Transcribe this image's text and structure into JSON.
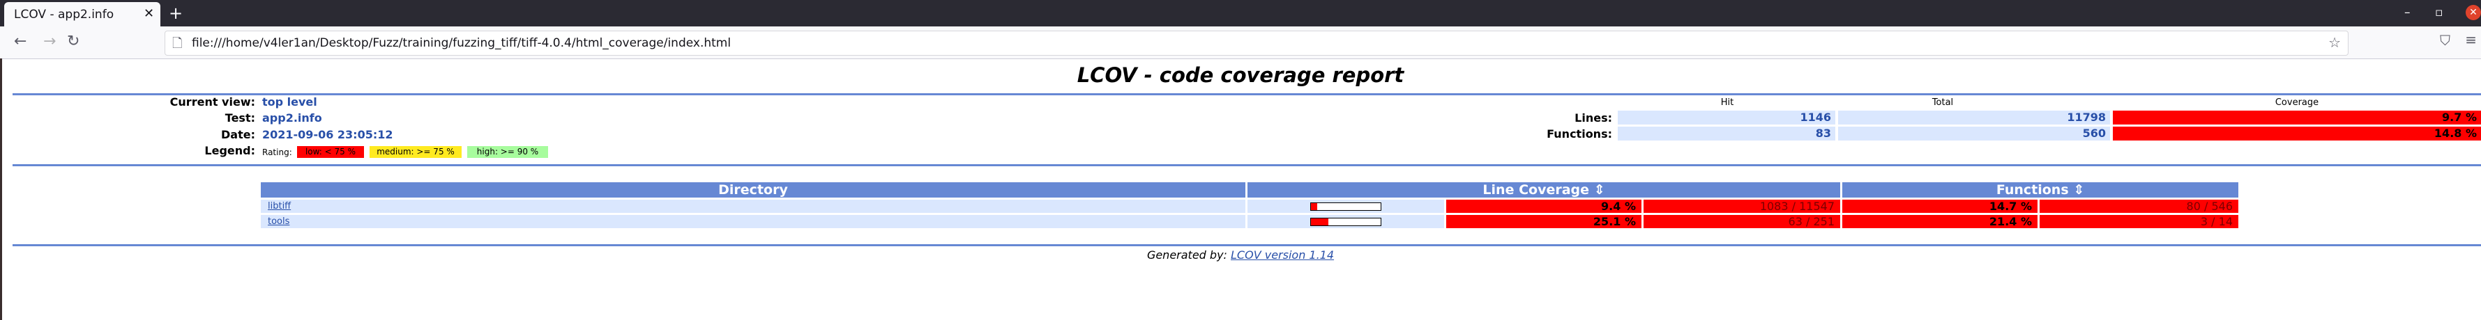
{
  "browser": {
    "tab_title": "LCOV - app2.info",
    "tab_close_icon": "close-icon",
    "new_tab_icon": "plus-icon",
    "url": "file:///home/v4ler1an/Desktop/Fuzz/training/fuzzing_tiff/tiff-4.0.4/html_coverage/index.html"
  },
  "report": {
    "title": "LCOV - code coverage report",
    "current_view_label": "Current view:",
    "current_view_value": "top level",
    "test_label": "Test:",
    "test_value": "app2.info",
    "date_label": "Date:",
    "date_value": "2021-09-06 23:05:12",
    "legend_label": "Legend:",
    "legend_rating": "Rating:",
    "legend_low": "low: < 75 %",
    "legend_medium": "medium: >= 75 %",
    "legend_high": "high: >= 90 %",
    "colors": {
      "low": "#ff0000",
      "medium": "#ffea20",
      "high": "#a7fc9d",
      "header": "#6688d4",
      "cell": "#dae7fe"
    }
  },
  "summary": {
    "col_hit": "Hit",
    "col_total": "Total",
    "col_coverage": "Coverage",
    "lines_label": "Lines:",
    "lines_hit": "1146",
    "lines_total": "11798",
    "lines_coverage": "9.7 %",
    "functions_label": "Functions:",
    "functions_hit": "83",
    "functions_total": "560",
    "functions_coverage": "14.8 %"
  },
  "table": {
    "col_directory": "Directory",
    "col_line_coverage": "Line Coverage ⇕",
    "col_functions": "Functions ⇕",
    "rows": [
      {
        "name": "libtiff",
        "line_pct": "9.4 %",
        "line_count": "1083 / 11547",
        "fn_pct": "14.7 %",
        "fn_count": "80 / 546",
        "bar_fraction": 0.094
      },
      {
        "name": "tools",
        "line_pct": "25.1 %",
        "line_count": "63 / 251",
        "fn_pct": "21.4 %",
        "fn_count": "3 / 14",
        "bar_fraction": 0.251
      }
    ]
  },
  "footer": {
    "generated_by": "Generated by:",
    "lcov_link": "LCOV version 1.14"
  }
}
